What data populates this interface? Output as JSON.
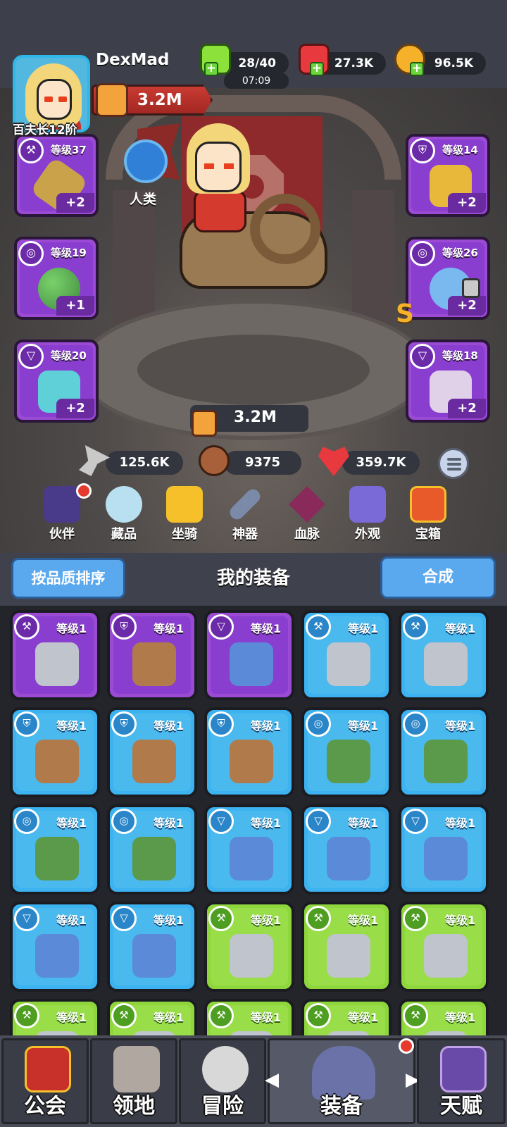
{
  "player": {
    "name": "DexMad",
    "rank": "百夫长12阶",
    "power": "3.2M"
  },
  "resources": {
    "energy": "28/40",
    "energy_timer": "07:09",
    "gems": "27.3K",
    "gold": "96.5K"
  },
  "race": {
    "label": "人类"
  },
  "slots": {
    "left": [
      {
        "level": "等级37",
        "plus": "+2"
      },
      {
        "level": "等级19",
        "plus": "+1"
      },
      {
        "level": "等级20",
        "plus": "+2"
      }
    ],
    "right": [
      {
        "level": "等级14",
        "plus": "+2"
      },
      {
        "level": "等级26",
        "plus": "+2",
        "grade": "S"
      },
      {
        "level": "等级18",
        "plus": "+2"
      }
    ]
  },
  "stats": {
    "total_power": "3.2M",
    "attack": "125.6K",
    "defense": "9375",
    "hp": "359.7K"
  },
  "features": [
    {
      "label": "伙伴",
      "icon": "partner-icon"
    },
    {
      "label": "藏品",
      "icon": "collection-icon"
    },
    {
      "label": "坐骑",
      "icon": "mount-icon"
    },
    {
      "label": "神器",
      "icon": "artifact-icon"
    },
    {
      "label": "血脉",
      "icon": "bloodline-icon"
    },
    {
      "label": "外观",
      "icon": "appearance-icon"
    },
    {
      "label": "宝箱",
      "icon": "chest-icon"
    }
  ],
  "toolbar": {
    "sort_label": "按品质排序",
    "title": "我的装备",
    "merge_label": "合成"
  },
  "inventory": [
    {
      "level": "等级1",
      "rarity": "purple",
      "type": "weapon"
    },
    {
      "level": "等级1",
      "rarity": "purple",
      "type": "armor"
    },
    {
      "level": "等级1",
      "rarity": "purple",
      "type": "necklace"
    },
    {
      "level": "等级1",
      "rarity": "blue",
      "type": "weapon"
    },
    {
      "level": "等级1",
      "rarity": "blue",
      "type": "weapon"
    },
    {
      "level": "等级1",
      "rarity": "blue",
      "type": "armor"
    },
    {
      "level": "等级1",
      "rarity": "blue",
      "type": "armor"
    },
    {
      "level": "等级1",
      "rarity": "blue",
      "type": "armor"
    },
    {
      "level": "等级1",
      "rarity": "blue",
      "type": "ring"
    },
    {
      "level": "等级1",
      "rarity": "blue",
      "type": "ring"
    },
    {
      "level": "等级1",
      "rarity": "blue",
      "type": "ring"
    },
    {
      "level": "等级1",
      "rarity": "blue",
      "type": "ring"
    },
    {
      "level": "等级1",
      "rarity": "blue",
      "type": "necklace"
    },
    {
      "level": "等级1",
      "rarity": "blue",
      "type": "necklace"
    },
    {
      "level": "等级1",
      "rarity": "blue",
      "type": "necklace"
    },
    {
      "level": "等级1",
      "rarity": "blue",
      "type": "necklace"
    },
    {
      "level": "等级1",
      "rarity": "blue",
      "type": "necklace"
    },
    {
      "level": "等级1",
      "rarity": "green",
      "type": "weapon"
    },
    {
      "level": "等级1",
      "rarity": "green",
      "type": "weapon"
    },
    {
      "level": "等级1",
      "rarity": "green",
      "type": "weapon"
    },
    {
      "level": "等级1",
      "rarity": "green",
      "type": "weapon"
    },
    {
      "level": "等级1",
      "rarity": "green",
      "type": "weapon"
    },
    {
      "level": "等级1",
      "rarity": "green",
      "type": "weapon"
    },
    {
      "level": "等级1",
      "rarity": "green",
      "type": "weapon"
    },
    {
      "level": "等级1",
      "rarity": "green",
      "type": "weapon"
    }
  ],
  "nav": [
    {
      "label": "公会",
      "icon": "guild-icon"
    },
    {
      "label": "领地",
      "icon": "territory-icon"
    },
    {
      "label": "冒险",
      "icon": "adventure-icon"
    },
    {
      "label": "装备",
      "icon": "equipment-icon"
    },
    {
      "label": "天赋",
      "icon": "talent-icon"
    }
  ],
  "colors": {
    "purple": "#9b4ad3",
    "blue": "#3cb3f0",
    "green": "#8fd63c",
    "accent": "#5aa8ee",
    "gold": "#f5b12a"
  }
}
